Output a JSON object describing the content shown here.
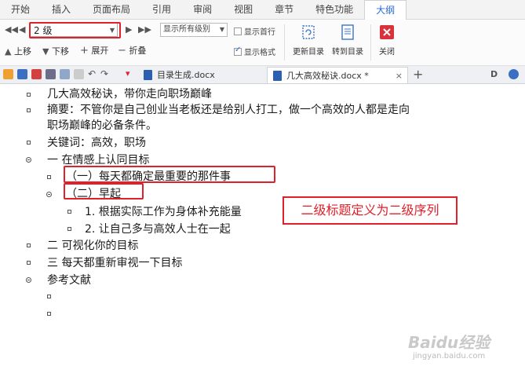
{
  "menu": [
    "开始",
    "插入",
    "页面布局",
    "引用",
    "审阅",
    "视图",
    "章节",
    "特色功能",
    "大纲"
  ],
  "toolbar": {
    "level_value": "2 级",
    "show_level": "显示所有级别",
    "show_first_line": "显示首行",
    "show_format": "显示格式",
    "up": "上移",
    "down": "下移",
    "expand": "展开",
    "collapse": "折叠",
    "update_toc": "更新目录",
    "goto_toc": "转到目录",
    "close": "关闭"
  },
  "tabs": [
    {
      "label": "目录生成.docx",
      "active": false
    },
    {
      "label": "几大高效秘诀.docx *",
      "active": true
    }
  ],
  "doc": {
    "title": "几大高效秘诀，带你走向职场巅峰",
    "abstract1": "摘要：不管你是自己创业当老板还是给别人打工，做一个高效的人都是走向",
    "abstract2": "职场巅峰的必备条件。",
    "keywords": "关键词：高效，职场",
    "h1_1": "一 在情感上认同目标",
    "h2_1": "（一）每天都确定最重要的那件事",
    "h2_2": "（二）早起",
    "h3_1": "1. 根据实际工作为身体补充能量",
    "h3_2": "2. 让自己多与高效人士在一起",
    "h1_2": "二 可视化你的目标",
    "h1_3": "三 每天都重新审视一下目标",
    "refs": "参考文献"
  },
  "annotation": "二级标题定义为二级序列",
  "watermark": "Baidu经验",
  "watermark_sub": "jingyan.baidu.com",
  "colors": {
    "accent": "#2a6bd1",
    "highlight": "#e0202a"
  }
}
